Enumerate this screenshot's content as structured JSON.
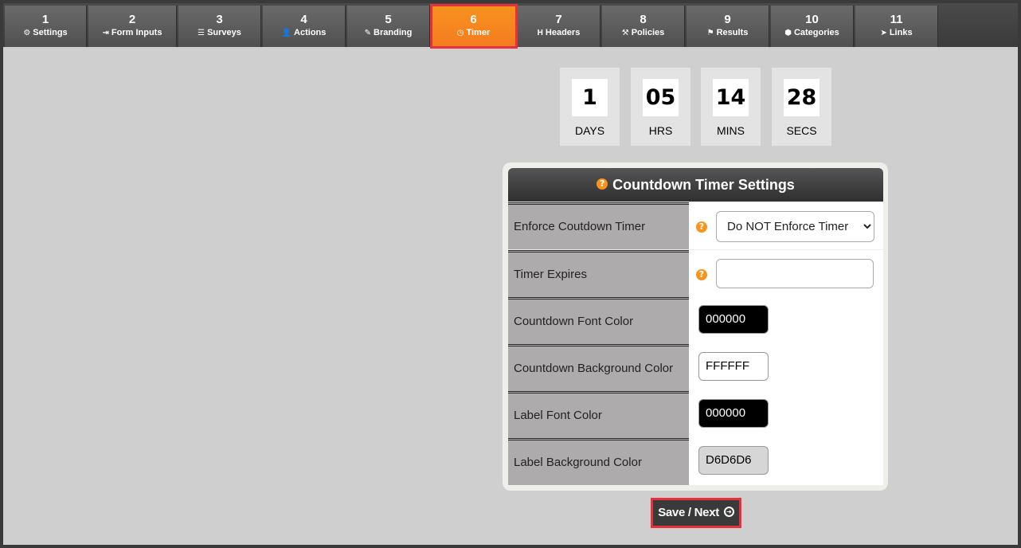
{
  "tabs": [
    {
      "num": "1",
      "label": "Settings",
      "icon": "⚙",
      "icon_name": "gear-icon"
    },
    {
      "num": "2",
      "label": "Form Inputs",
      "icon": "⇥",
      "icon_name": "sign-in-icon"
    },
    {
      "num": "3",
      "label": "Surveys",
      "icon": "☰",
      "icon_name": "list-icon"
    },
    {
      "num": "4",
      "label": "Actions",
      "icon": "👤",
      "icon_name": "user-icon"
    },
    {
      "num": "5",
      "label": "Branding",
      "icon": "✎",
      "icon_name": "brush-icon"
    },
    {
      "num": "6",
      "label": "Timer",
      "icon": "◷",
      "icon_name": "clock-icon"
    },
    {
      "num": "7",
      "label": "Headers",
      "icon": "H",
      "icon_name": "header-icon"
    },
    {
      "num": "8",
      "label": "Policies",
      "icon": "⚒",
      "icon_name": "gavel-icon"
    },
    {
      "num": "9",
      "label": "Results",
      "icon": "⚑",
      "icon_name": "flag-icon"
    },
    {
      "num": "10",
      "label": "Categories",
      "icon": "⬢",
      "icon_name": "cubes-icon"
    },
    {
      "num": "11",
      "label": "Links",
      "icon": "➤",
      "icon_name": "pointer-icon"
    }
  ],
  "active_tab": "6",
  "countdown": {
    "days": {
      "value": "1",
      "label": "DAYS"
    },
    "hrs": {
      "value": "05",
      "label": "HRS"
    },
    "mins": {
      "value": "14",
      "label": "MINS"
    },
    "secs": {
      "value": "28",
      "label": "SECS"
    }
  },
  "panel": {
    "title": "Countdown Timer Settings",
    "rows": {
      "enforce": {
        "label": "Enforce Coutdown Timer",
        "value": "Do NOT Enforce Timer"
      },
      "expires": {
        "label": "Timer Expires",
        "value": ""
      },
      "font_color": {
        "label": "Countdown Font Color",
        "value": "000000"
      },
      "bg_color": {
        "label": "Countdown Background Color",
        "value": "FFFFFF"
      },
      "label_font_color": {
        "label": "Label Font Color",
        "value": "000000"
      },
      "label_bg_color": {
        "label": "Label Background Color",
        "value": "D6D6D6"
      }
    }
  },
  "colors": {
    "accent": "#f47b20",
    "highlight_outline": "#e8303a",
    "help_icon": "#f7941d"
  },
  "save_button": {
    "label": "Save / Next"
  }
}
